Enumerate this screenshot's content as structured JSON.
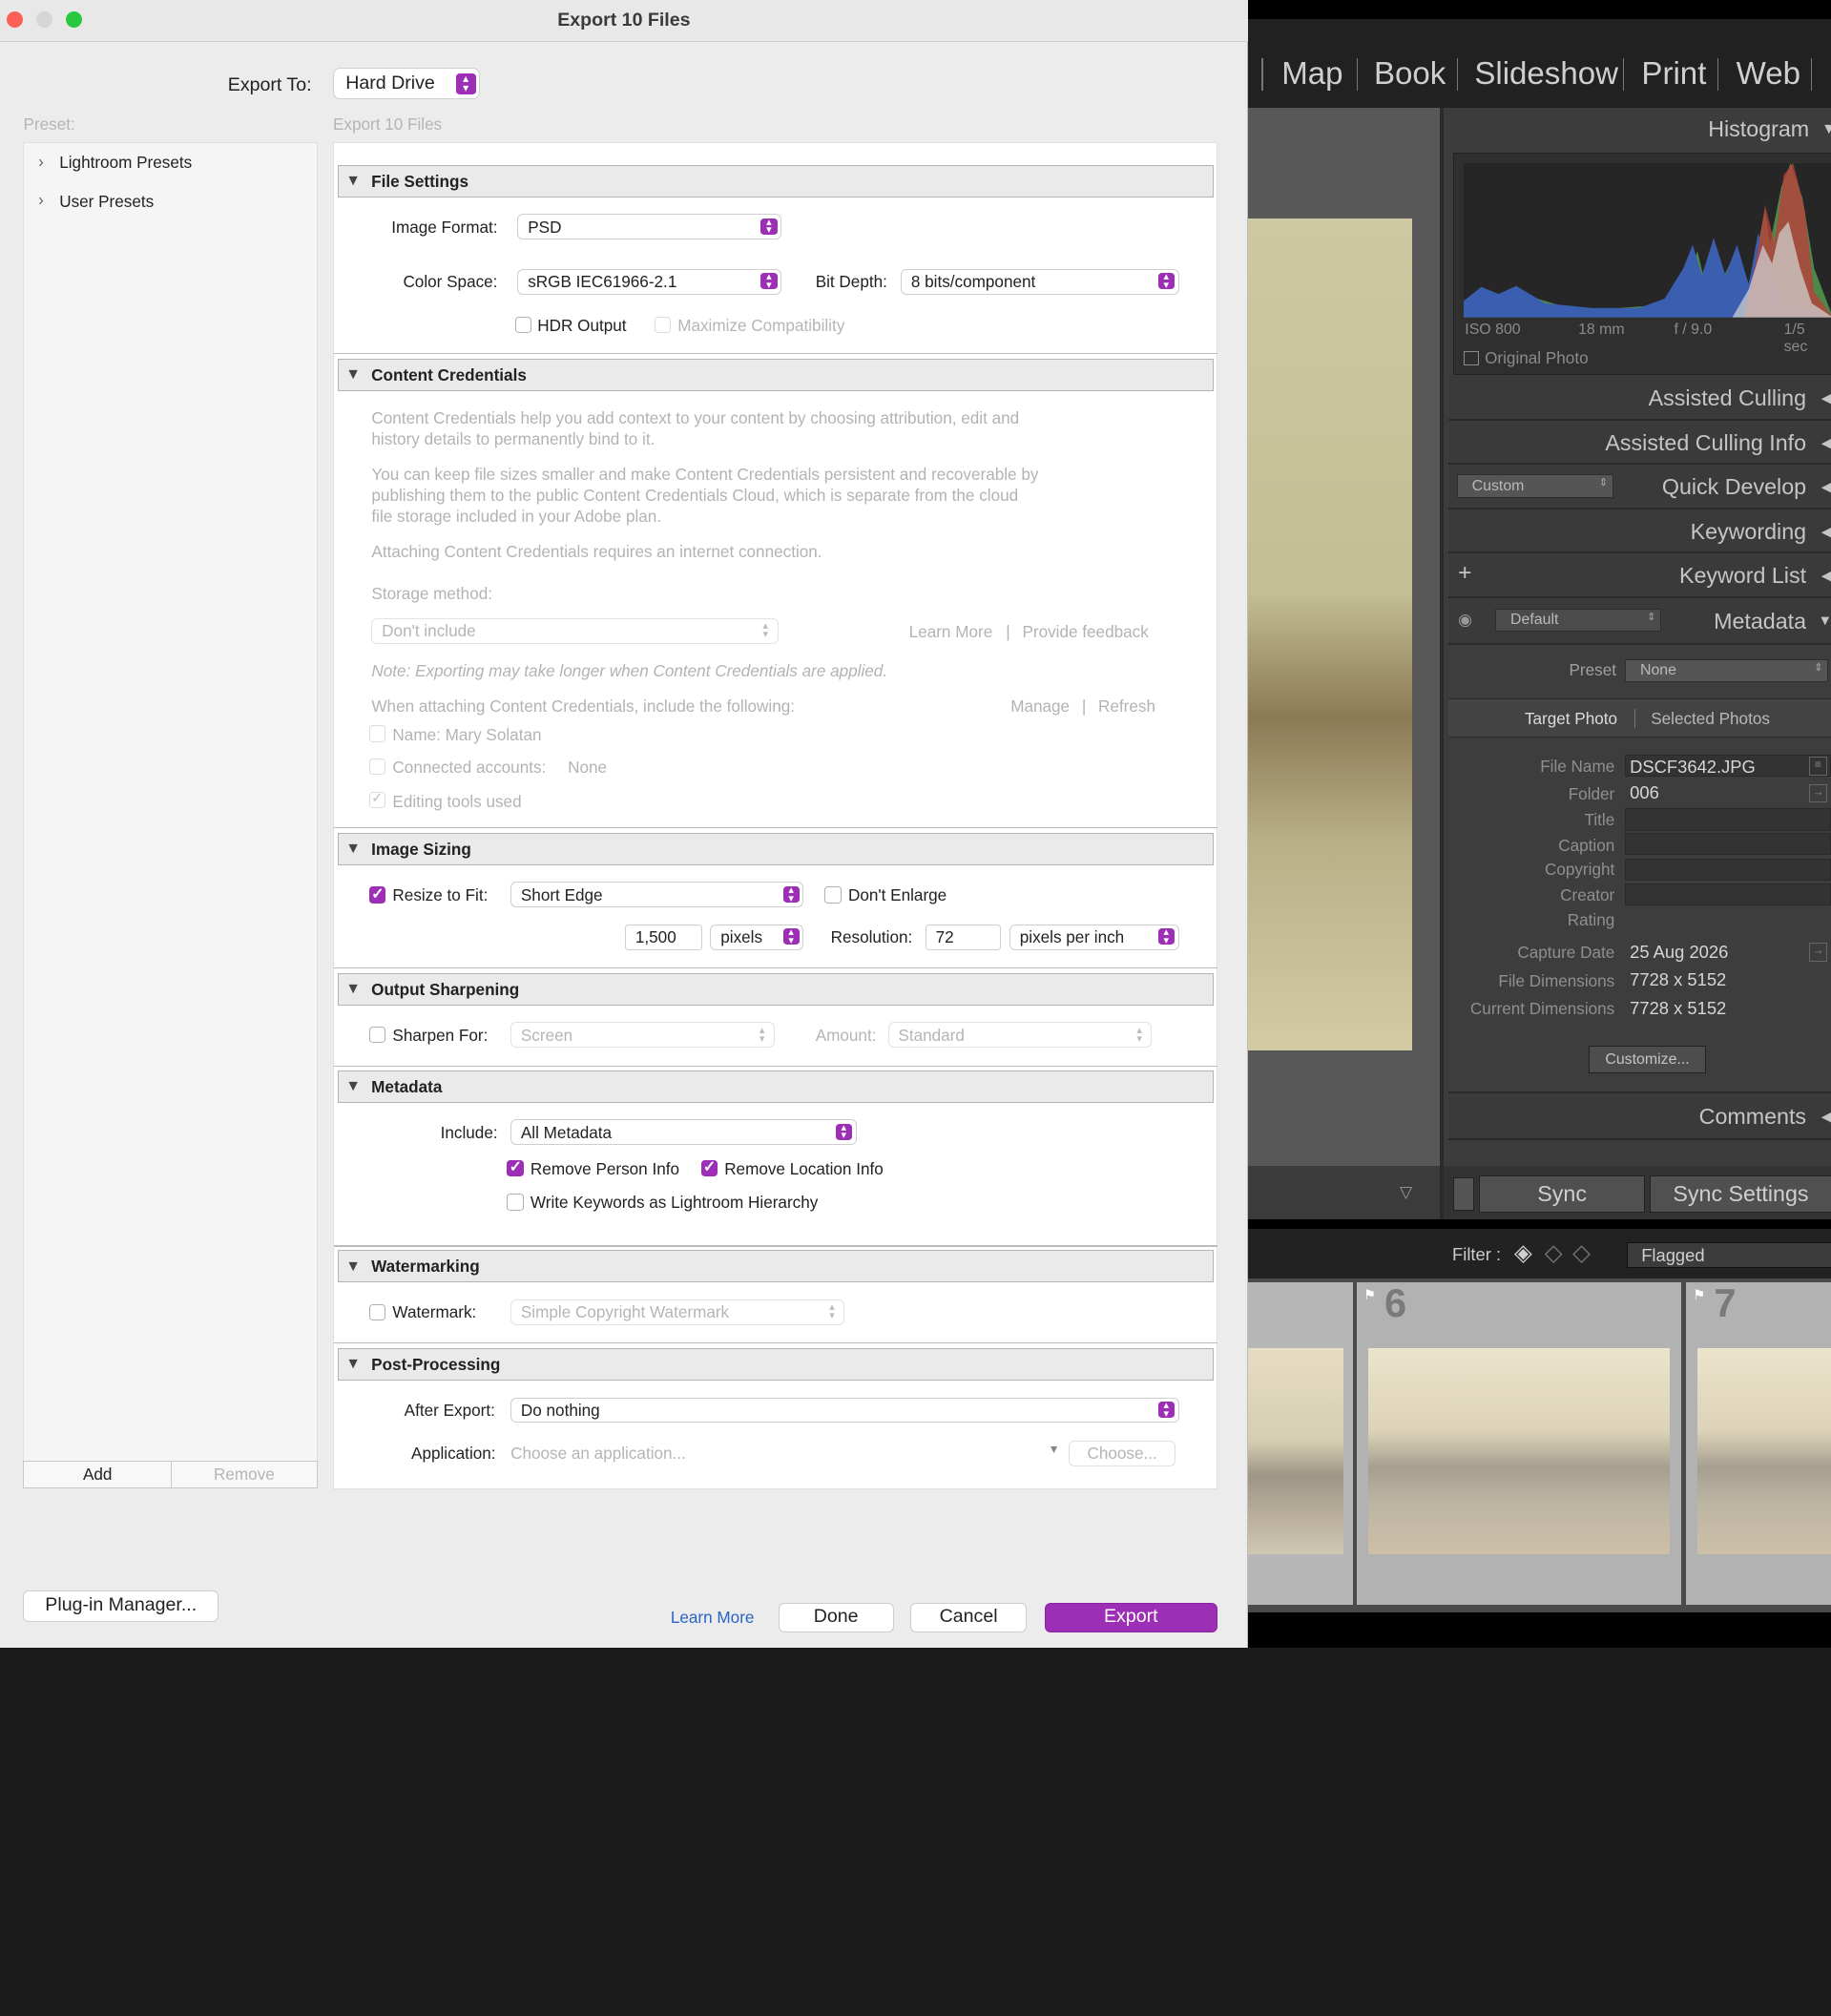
{
  "window": {
    "title": "Export 10 Files"
  },
  "export_to": {
    "label": "Export To:",
    "value": "Hard Drive"
  },
  "preset": {
    "label": "Preset:",
    "items": [
      "Lightroom Presets",
      "User Presets"
    ],
    "add": "Add",
    "remove": "Remove"
  },
  "subtitle": "Export 10 Files",
  "file_settings": {
    "title": "File Settings",
    "image_format_label": "Image Format:",
    "image_format": "PSD",
    "color_space_label": "Color Space:",
    "color_space": "sRGB IEC61966-2.1",
    "bit_depth_label": "Bit Depth:",
    "bit_depth": "8 bits/component",
    "hdr": "HDR Output",
    "maximize": "Maximize Compatibility"
  },
  "content_credentials": {
    "title": "Content Credentials",
    "p1a": "Content Credentials help you add context to your content by choosing attribution, edit and",
    "p1b": "history details to permanently bind to it.",
    "p2a": "You can keep file sizes smaller and make Content Credentials persistent and recoverable by",
    "p2b": "publishing them to the public Content Credentials Cloud, which is separate from the cloud",
    "p2c": "file storage included in your Adobe plan.",
    "p3": "Attaching Content Credentials requires an internet connection.",
    "storage_label": "Storage method:",
    "storage": "Don't include",
    "learn_more": "Learn More",
    "provide_feedback": "Provide feedback",
    "note": "Note: Exporting may take longer when Content Credentials are applied.",
    "include_label": "When attaching Content Credentials, include the following:",
    "manage": "Manage",
    "refresh": "Refresh",
    "name": "Name: Mary Solatan",
    "connected": "Connected accounts:",
    "connected_val": "None",
    "editing": "Editing tools used"
  },
  "image_sizing": {
    "title": "Image Sizing",
    "resize_label": "Resize to Fit:",
    "resize": "Short Edge",
    "dont_enlarge": "Don't Enlarge",
    "size": "1,500",
    "units": "pixels",
    "resolution_label": "Resolution:",
    "resolution": "72",
    "res_units": "pixels per inch"
  },
  "output_sharpening": {
    "title": "Output Sharpening",
    "sharpen_label": "Sharpen For:",
    "sharpen": "Screen",
    "amount_label": "Amount:",
    "amount": "Standard"
  },
  "metadata": {
    "title": "Metadata",
    "include_label": "Include:",
    "include": "All Metadata",
    "remove_person": "Remove Person Info",
    "remove_location": "Remove Location Info",
    "write_keywords": "Write Keywords as Lightroom Hierarchy"
  },
  "watermarking": {
    "title": "Watermarking",
    "label": "Watermark:",
    "value": "Simple Copyright Watermark"
  },
  "post_processing": {
    "title": "Post-Processing",
    "after_label": "After Export:",
    "after": "Do nothing",
    "app_label": "Application:",
    "app_placeholder": "Choose an application...",
    "choose": "Choose..."
  },
  "footer": {
    "plugin_manager": "Plug-in Manager...",
    "learn_more": "Learn More",
    "done": "Done",
    "cancel": "Cancel",
    "export": "Export"
  },
  "lightroom": {
    "modules": [
      "Map",
      "Book",
      "Slideshow",
      "Print",
      "Web"
    ],
    "histogram": "Histogram",
    "iso": "ISO 800",
    "focal": "18 mm",
    "aperture": "f / 9.0",
    "shutter": "1/5 sec",
    "original_photo": "Original Photo",
    "assisted_culling": "Assisted Culling",
    "assisted_culling_info": "Assisted Culling Info",
    "custom": "Custom",
    "quick_develop": "Quick Develop",
    "keywording": "Keywording",
    "keyword_list": "Keyword List",
    "default": "Default",
    "metadata": "Metadata",
    "preset_label": "Preset",
    "preset": "None",
    "target_photo": "Target Photo",
    "selected_photos": "Selected Photos",
    "file_name_label": "File Name",
    "file_name": "DSCF3642.JPG",
    "folder_label": "Folder",
    "folder": "006",
    "title_label": "Title",
    "caption_label": "Caption",
    "copyright_label": "Copyright",
    "creator_label": "Creator",
    "rating_label": "Rating",
    "capture_date_label": "Capture Date",
    "capture_date": "25 Aug 2026",
    "file_dim_label": "File Dimensions",
    "file_dim": "7728 x 5152",
    "cur_dim_label": "Current Dimensions",
    "cur_dim": "7728 x 5152",
    "customize": "Customize...",
    "comments": "Comments",
    "sync": "Sync",
    "sync_settings": "Sync Settings",
    "filter_label": "Filter :",
    "filter": "Flagged",
    "thumb6": "6",
    "thumb7": "7"
  },
  "colors": {
    "accent": "#9c2fb6",
    "link": "#2a64c4"
  }
}
